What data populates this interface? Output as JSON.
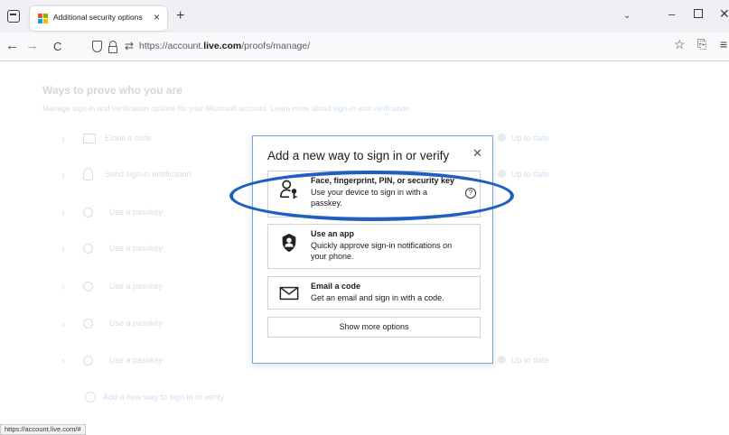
{
  "browser": {
    "tab_title": "Additional security options",
    "url_prefix": "https://account.",
    "url_domain": "live.com",
    "url_path": "/proofs/manage/",
    "tab_close": "×",
    "new_tab": "+",
    "list_tabs": "⌄",
    "minimize": "–",
    "close": "✕",
    "back": "←",
    "forward": "→",
    "reload": "C",
    "bookmark": "☆",
    "extensions": "⎘",
    "menu": "≡",
    "permissions": "⇄",
    "ms_logo_colors": [
      "#f25022",
      "#7fba00",
      "#00a4ef",
      "#ffb900"
    ]
  },
  "page": {
    "heading": "Ways to prove who you are",
    "subheading": "Manage sign-in and verification options for your Microsoft account.",
    "sub_link": "Learn more about sign-in and verification.",
    "rows": [
      {
        "label": "Email a code",
        "icon": "mail-icon",
        "status": "Up to date"
      },
      {
        "label": "Send sign-in notification",
        "icon": "lock-icon",
        "status": "Up to date"
      },
      {
        "label": "Use a passkey",
        "icon": "passkey-icon",
        "status": ""
      },
      {
        "label": "Use a passkey",
        "icon": "passkey-icon",
        "status": ""
      },
      {
        "label": "Use a passkey",
        "icon": "passkey-icon",
        "status": ""
      },
      {
        "label": "Use a passkey",
        "icon": "passkey-icon",
        "status": ""
      },
      {
        "label": "Use a passkey",
        "icon": "passkey-icon",
        "status": "Up to date"
      }
    ],
    "add_link": "Add a new way to sign in or verify"
  },
  "dialog": {
    "title": "Add a new way to sign in or verify",
    "close": "✕",
    "options": [
      {
        "title": "Face, fingerprint, PIN, or security key",
        "description": "Use your device to sign in with a passkey.",
        "icon": "passkey-icon",
        "help": "?"
      },
      {
        "title": "Use an app",
        "description": "Quickly approve sign-in notifications on your phone.",
        "icon": "authenticator-app-icon"
      },
      {
        "title": "Email a code",
        "description": "Get an email and sign in with a code.",
        "icon": "mail-icon"
      }
    ],
    "more_button": "Show more options"
  },
  "status_bar_url": "https://account.live.com/#",
  "annotation_color": "#1f5fc4"
}
